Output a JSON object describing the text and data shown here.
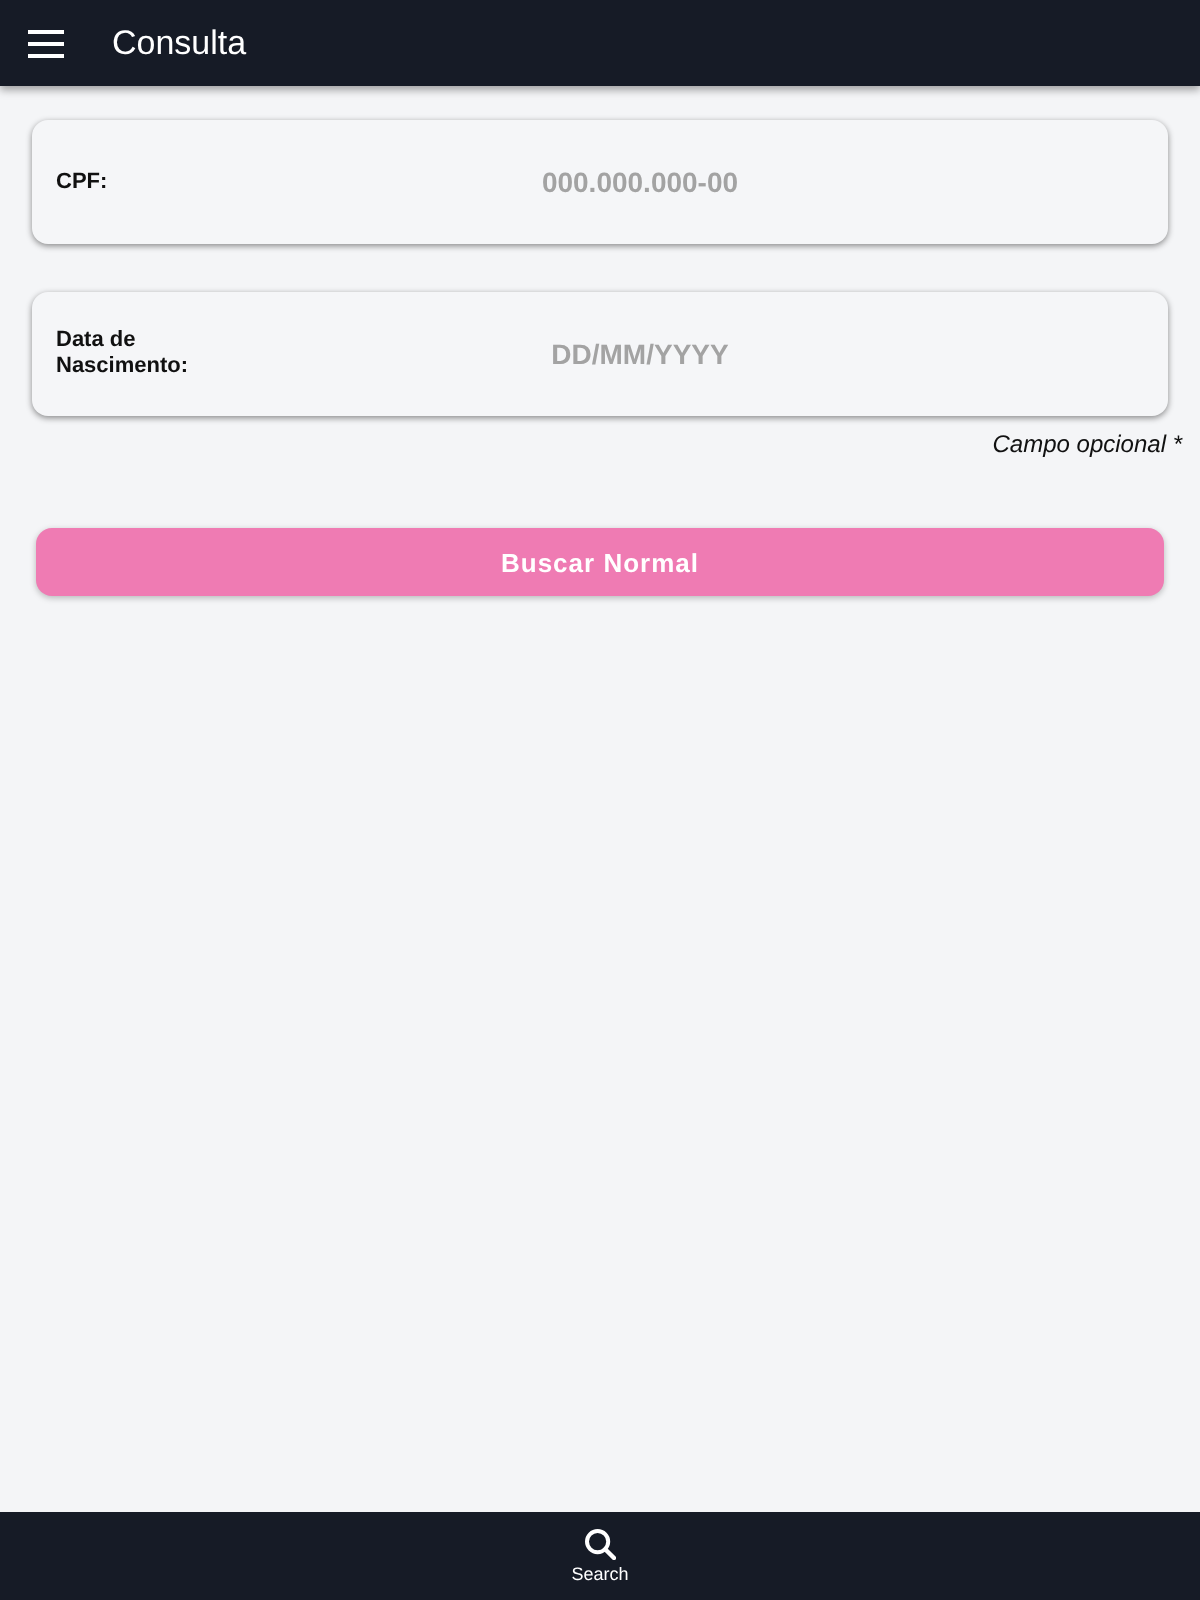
{
  "app_bar": {
    "title": "Consulta"
  },
  "fields": [
    {
      "label": "CPF:",
      "placeholder": "000.000.000-00"
    },
    {
      "label": "Data de Nascimento:",
      "placeholder": "DD/MM/YYYY",
      "note": "Campo opcional *"
    }
  ],
  "search_button": {
    "label": "Buscar Normal"
  },
  "bottom_nav": [
    {
      "label": "Search",
      "selected": true
    }
  ]
}
